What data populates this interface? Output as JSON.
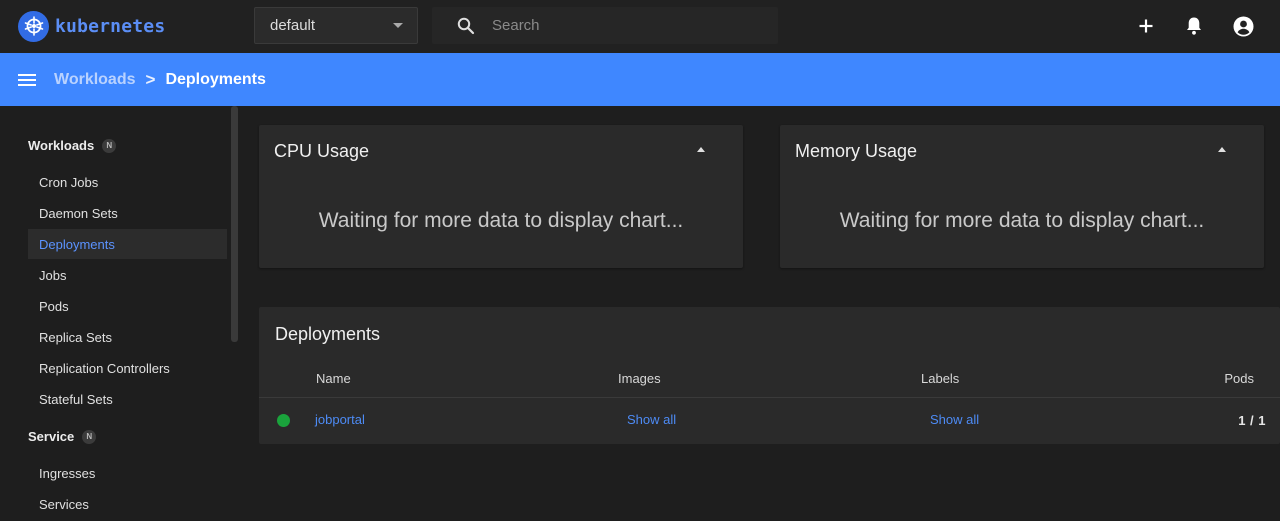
{
  "app": {
    "logo_text": "kubernetes"
  },
  "namespace": {
    "selected": "default"
  },
  "search": {
    "placeholder": "Search"
  },
  "header": {
    "breadcrumb_parent": "Workloads",
    "breadcrumb_separator": ">",
    "breadcrumb_current": "Deployments"
  },
  "sidebar": {
    "sections": [
      {
        "label": "Workloads",
        "badge": "N"
      },
      {
        "label": "Service",
        "badge": "N"
      }
    ],
    "workload_items": [
      "Cron Jobs",
      "Daemon Sets",
      "Deployments",
      "Jobs",
      "Pods",
      "Replica Sets",
      "Replication Controllers",
      "Stateful Sets"
    ],
    "service_items": [
      "Ingresses",
      "Services"
    ],
    "active_item": "Deployments"
  },
  "cpu_card": {
    "title": "CPU Usage",
    "message": "Waiting for more data to display chart..."
  },
  "memory_card": {
    "title": "Memory Usage",
    "message": "Waiting for more data to display chart..."
  },
  "deployments": {
    "title": "Deployments",
    "columns": [
      "Name",
      "Images",
      "Labels",
      "Pods"
    ],
    "rows": [
      {
        "status": "running",
        "name": "jobportal",
        "images": "Show all",
        "labels": "Show all",
        "pods": "1 / 1"
      }
    ]
  },
  "colors": {
    "header_blue": "#3f87ff",
    "logo_blue": "#326ce5",
    "link_blue": "#4d8bf5",
    "status_green": "#1aa33c"
  }
}
